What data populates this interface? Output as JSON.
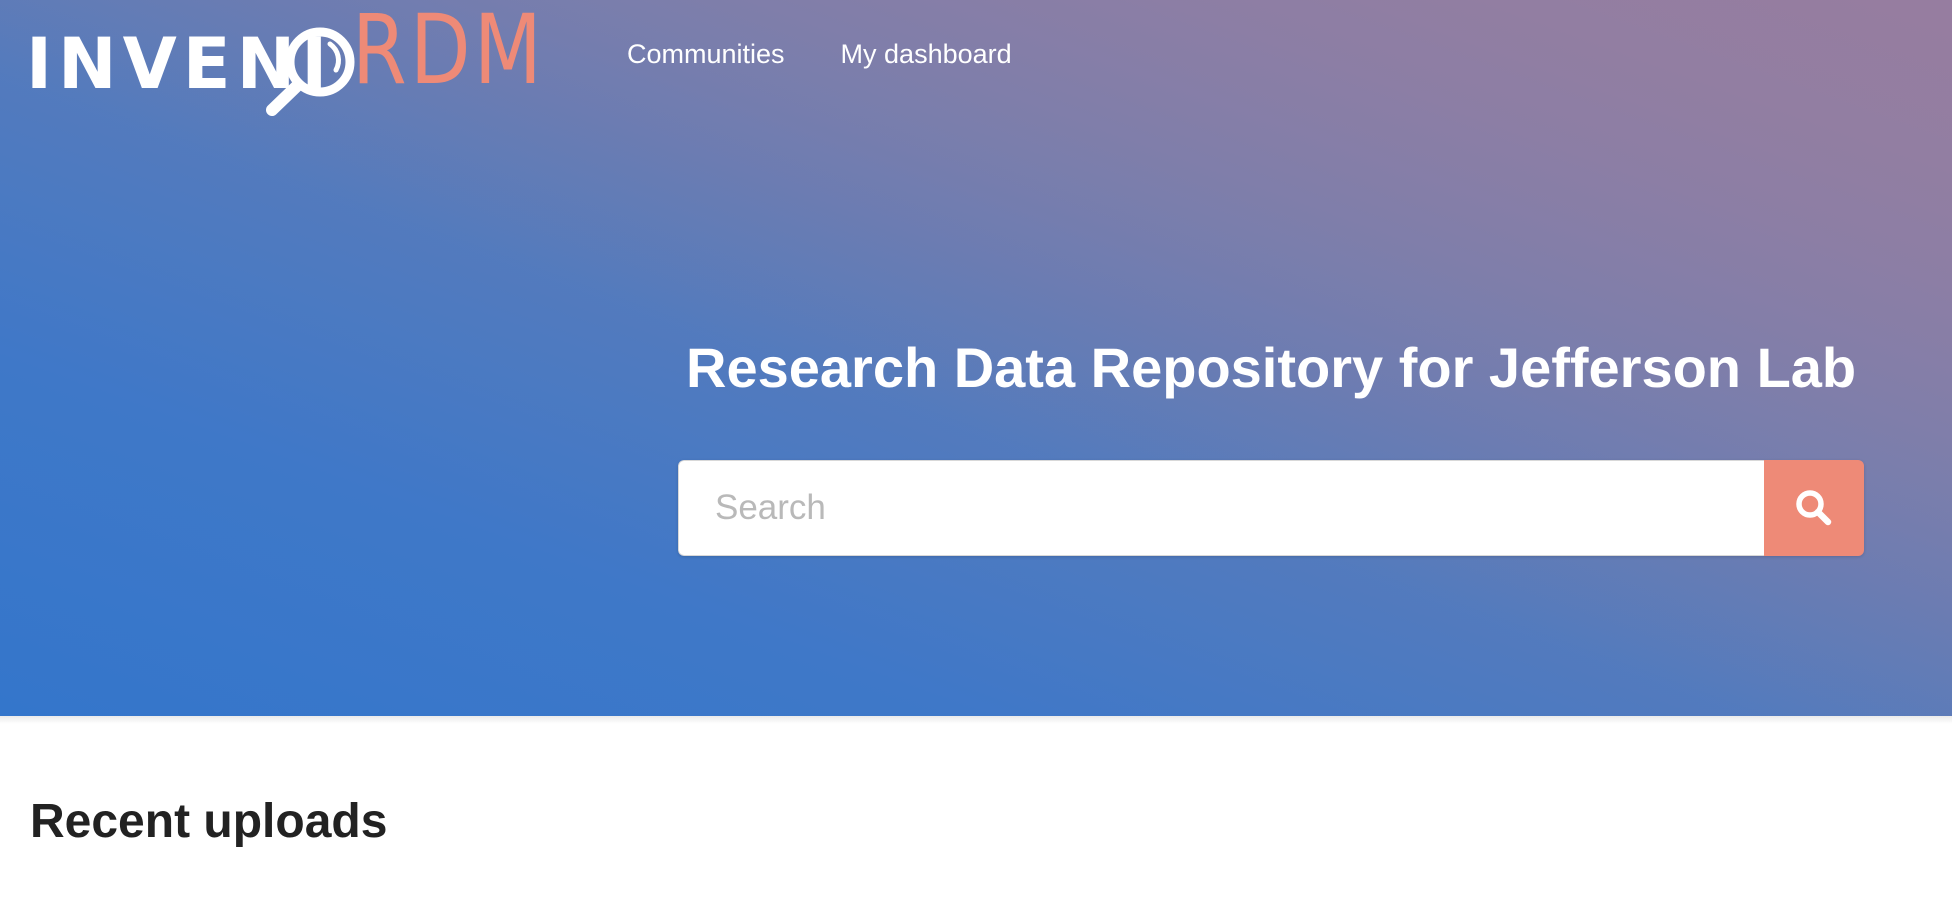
{
  "brand": {
    "logo_part1": "INVENI",
    "logo_part2": "RDM",
    "accent_color": "#ee8a77"
  },
  "nav": {
    "items": [
      {
        "label": "Communities"
      },
      {
        "label": "My dashboard"
      }
    ]
  },
  "hero": {
    "title": "Research Data Repository for Jefferson Lab",
    "search": {
      "placeholder": "Search",
      "value": "",
      "button_icon": "search-icon"
    }
  },
  "main": {
    "recent_uploads_title": "Recent uploads"
  }
}
